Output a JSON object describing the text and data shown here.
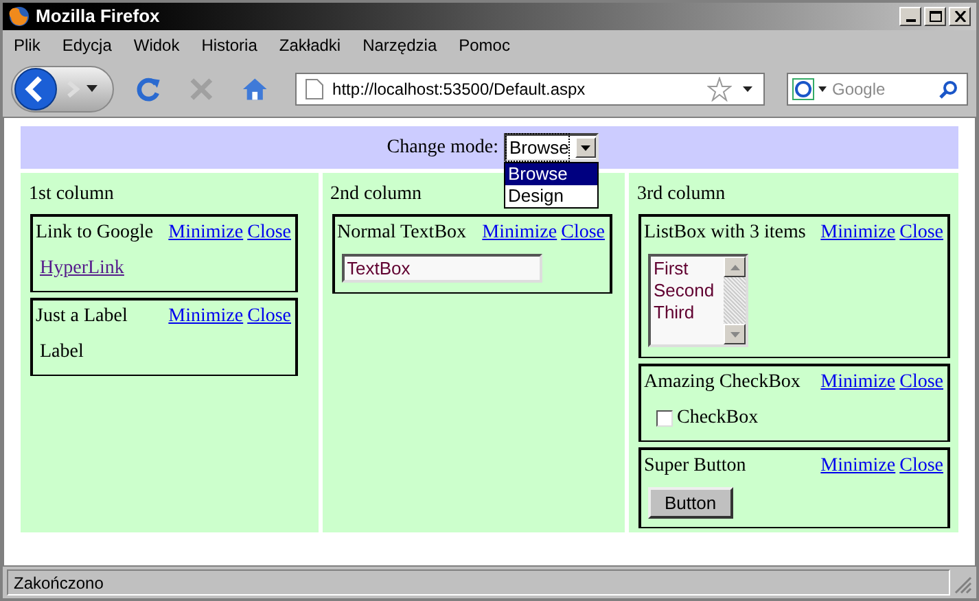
{
  "window": {
    "title": "Mozilla Firefox"
  },
  "menu": [
    "Plik",
    "Edycja",
    "Widok",
    "Historia",
    "Zakładki",
    "Narzędzia",
    "Pomoc"
  ],
  "toolbar": {
    "url": "http://localhost:53500/Default.aspx",
    "search_placeholder": "Google"
  },
  "page": {
    "mode_label": "Change mode:",
    "mode_value": "Browse",
    "mode_options": [
      {
        "label": "Browse",
        "selected": true
      },
      {
        "label": "Design",
        "selected": false
      }
    ],
    "columns": [
      {
        "title": "1st column",
        "parts": [
          {
            "title": "Link to Google",
            "actions": [
              "Minimize",
              "Close"
            ],
            "content": {
              "kind": "hyperlink",
              "text": "HyperLink"
            }
          },
          {
            "title": "Just a Label",
            "actions": [
              "Minimize",
              "Close"
            ],
            "content": {
              "kind": "label",
              "text": "Label"
            }
          }
        ]
      },
      {
        "title": "2nd column",
        "parts": [
          {
            "title": "Normal TextBox",
            "actions": [
              "Minimize",
              "Close"
            ],
            "content": {
              "kind": "textbox",
              "value": "TextBox"
            }
          }
        ]
      },
      {
        "title": "3rd column",
        "parts": [
          {
            "title": "ListBox with 3 items",
            "actions": [
              "Minimize",
              "Close"
            ],
            "content": {
              "kind": "listbox",
              "items": [
                "First",
                "Second",
                "Third"
              ]
            }
          },
          {
            "title": "Amazing CheckBox",
            "actions": [
              "Minimize",
              "Close"
            ],
            "content": {
              "kind": "checkbox",
              "label": "CheckBox",
              "checked": false
            }
          },
          {
            "title": "Super Button",
            "actions": [
              "Minimize",
              "Close"
            ],
            "content": {
              "kind": "button",
              "label": "Button"
            }
          }
        ]
      }
    ]
  },
  "status_bar": "Zakończono"
}
